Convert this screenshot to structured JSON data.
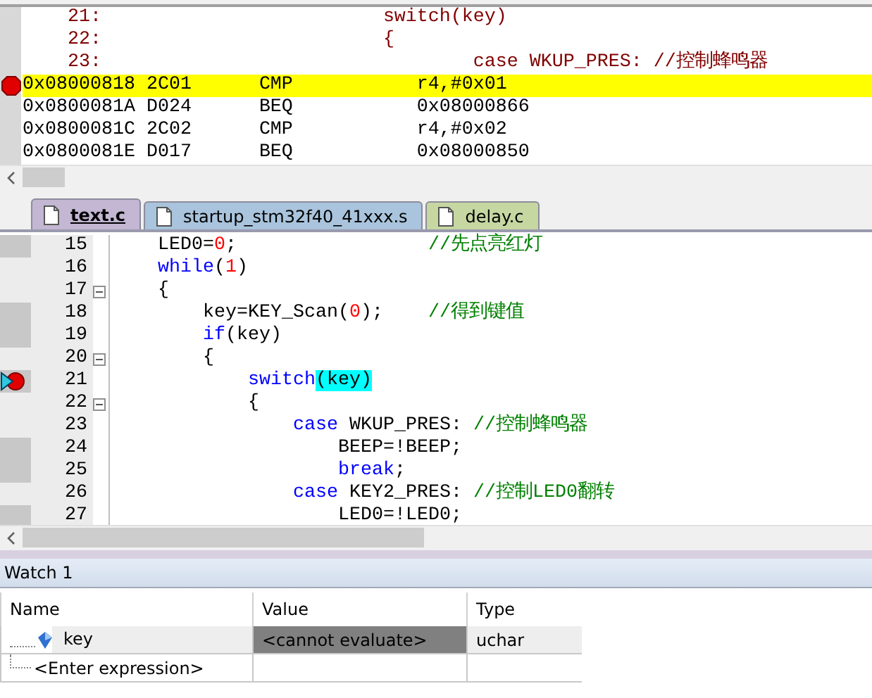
{
  "disassembly": {
    "rows": [
      {
        "kind": "source",
        "line": "21:",
        "code": "switch(key)",
        "selected": false,
        "breakpoint": false
      },
      {
        "kind": "source",
        "line": "22:",
        "code": "{",
        "selected": false,
        "breakpoint": false
      },
      {
        "kind": "source",
        "line": "23:",
        "code": "        case WKUP_PRES: //控制蜂鸣器",
        "selected": false,
        "breakpoint": false
      },
      {
        "kind": "asm",
        "address": "0x08000818",
        "opcode": "2C01",
        "mnemonic": "CMP",
        "operand": "r4,#0x01",
        "selected": true,
        "breakpoint": true
      },
      {
        "kind": "asm",
        "address": "0x0800081A",
        "opcode": "D024",
        "mnemonic": "BEQ",
        "operand": "0x08000866",
        "selected": false,
        "breakpoint": false
      },
      {
        "kind": "asm",
        "address": "0x0800081C",
        "opcode": "2C02",
        "mnemonic": "CMP",
        "operand": "r4,#0x02",
        "selected": false,
        "breakpoint": false
      },
      {
        "kind": "asm",
        "address": "0x0800081E",
        "opcode": "D017",
        "mnemonic": "BEQ",
        "operand": "0x08000850",
        "selected": false,
        "breakpoint": false
      }
    ]
  },
  "tabs": [
    {
      "label": "text.c",
      "selected": true,
      "color": "#c3b7d3"
    },
    {
      "label": "startup_stm32f40_41xxx.s",
      "selected": false,
      "color": "#a9c4dc"
    },
    {
      "label": "delay.c",
      "selected": false,
      "color": "#c6d7a2"
    }
  ],
  "editor": {
    "lines": [
      {
        "number": "15",
        "code_mark": true,
        "breakpoint": false,
        "current": false,
        "fold": false,
        "tokens": [
          {
            "kind": "plain",
            "text": "    LED0="
          },
          {
            "kind": "number",
            "text": "0"
          },
          {
            "kind": "plain",
            "text": ";                 "
          },
          {
            "kind": "comment",
            "text": "//先点亮红灯"
          }
        ]
      },
      {
        "number": "16",
        "code_mark": false,
        "breakpoint": false,
        "current": false,
        "fold": false,
        "tokens": [
          {
            "kind": "keyword",
            "text": "    while"
          },
          {
            "kind": "plain",
            "text": "("
          },
          {
            "kind": "number",
            "text": "1"
          },
          {
            "kind": "plain",
            "text": ")"
          }
        ]
      },
      {
        "number": "17",
        "code_mark": false,
        "breakpoint": false,
        "current": false,
        "fold": true,
        "tokens": [
          {
            "kind": "plain",
            "text": "    {"
          }
        ]
      },
      {
        "number": "18",
        "code_mark": true,
        "breakpoint": false,
        "current": false,
        "fold": false,
        "tokens": [
          {
            "kind": "plain",
            "text": "        key=KEY_Scan("
          },
          {
            "kind": "number",
            "text": "0"
          },
          {
            "kind": "plain",
            "text": ");    "
          },
          {
            "kind": "comment",
            "text": "//得到键值"
          }
        ]
      },
      {
        "number": "19",
        "code_mark": true,
        "breakpoint": false,
        "current": false,
        "fold": false,
        "tokens": [
          {
            "kind": "keyword",
            "text": "        if"
          },
          {
            "kind": "plain",
            "text": "(key)"
          }
        ]
      },
      {
        "number": "20",
        "code_mark": false,
        "breakpoint": false,
        "current": false,
        "fold": true,
        "tokens": [
          {
            "kind": "plain",
            "text": "        {"
          }
        ]
      },
      {
        "number": "21",
        "code_mark": true,
        "breakpoint": true,
        "current": true,
        "fold": false,
        "tokens": [
          {
            "kind": "keyword",
            "text": "            switch"
          },
          {
            "kind": "match",
            "text": "(key)"
          }
        ]
      },
      {
        "number": "22",
        "code_mark": false,
        "breakpoint": false,
        "current": false,
        "fold": true,
        "tokens": [
          {
            "kind": "plain",
            "text": "            {"
          }
        ]
      },
      {
        "number": "23",
        "code_mark": false,
        "breakpoint": false,
        "current": false,
        "fold": false,
        "tokens": [
          {
            "kind": "keyword",
            "text": "                case"
          },
          {
            "kind": "plain",
            "text": " WKUP_PRES: "
          },
          {
            "kind": "comment",
            "text": "//控制蜂鸣器"
          }
        ]
      },
      {
        "number": "24",
        "code_mark": true,
        "breakpoint": false,
        "current": false,
        "fold": false,
        "tokens": [
          {
            "kind": "plain",
            "text": "                    BEEP=!BEEP;"
          }
        ]
      },
      {
        "number": "25",
        "code_mark": true,
        "breakpoint": false,
        "current": false,
        "fold": false,
        "tokens": [
          {
            "kind": "keyword",
            "text": "                    break"
          },
          {
            "kind": "plain",
            "text": ";"
          }
        ]
      },
      {
        "number": "26",
        "code_mark": false,
        "breakpoint": false,
        "current": false,
        "fold": false,
        "tokens": [
          {
            "kind": "keyword",
            "text": "                case"
          },
          {
            "kind": "plain",
            "text": " KEY2_PRES: "
          },
          {
            "kind": "comment",
            "text": "//控制LED0翻转"
          }
        ]
      },
      {
        "number": "27",
        "code_mark": true,
        "breakpoint": false,
        "current": false,
        "fold": false,
        "tokens": [
          {
            "kind": "plain",
            "text": "                    LED0=!LED0;"
          }
        ]
      }
    ]
  },
  "watch": {
    "title": "Watch 1",
    "columns": [
      "Name",
      "Value",
      "Type"
    ],
    "rows": [
      {
        "kind": "variable",
        "name": "key",
        "value": "<cannot evaluate>",
        "type": "uchar"
      },
      {
        "kind": "entry",
        "name": "<Enter expression>"
      }
    ]
  }
}
